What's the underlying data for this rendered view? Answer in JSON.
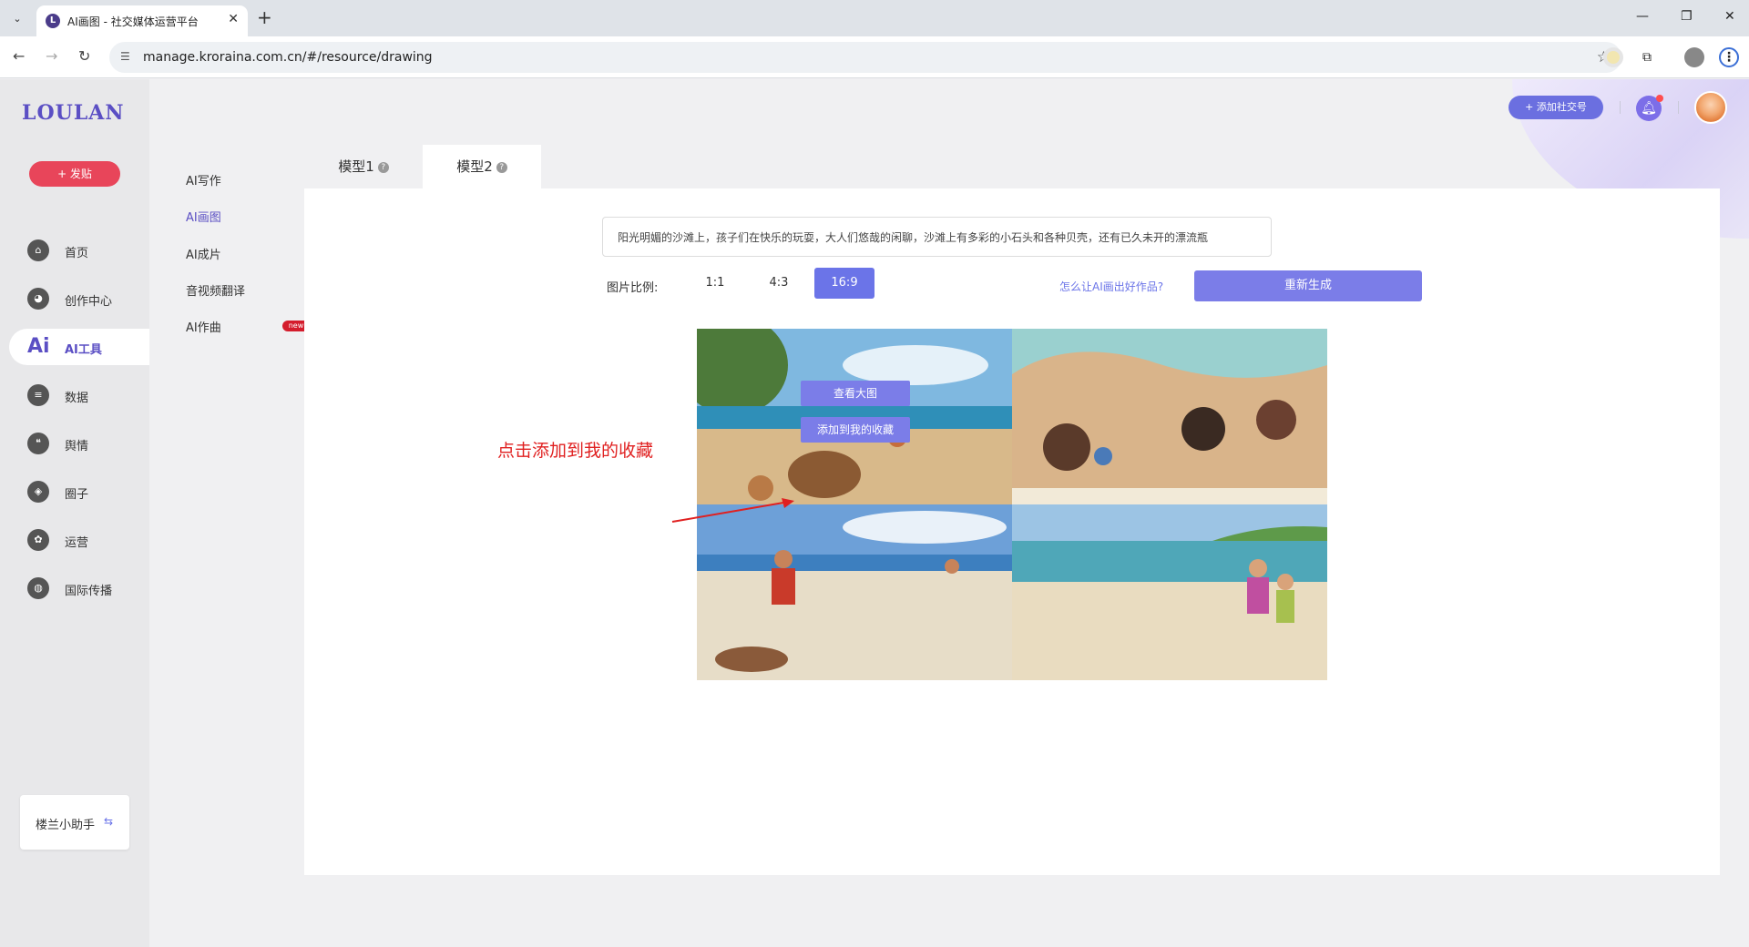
{
  "browser": {
    "tab_title": "AI画图 - 社交媒体运营平台",
    "url": "manage.kroraina.com.cn/#/resource/drawing"
  },
  "brand": {
    "logo": "LOULAN"
  },
  "sidebar": {
    "post_button": "+ 发贴",
    "items": [
      {
        "label": "首页",
        "icon": "home-icon"
      },
      {
        "label": "创作中心",
        "icon": "palette-icon"
      },
      {
        "label": "AI工具",
        "icon": "ai-icon",
        "active": true
      },
      {
        "label": "数据",
        "icon": "database-icon"
      },
      {
        "label": "舆情",
        "icon": "quote-icon"
      },
      {
        "label": "圈子",
        "icon": "compass-icon"
      },
      {
        "label": "运营",
        "icon": "operations-icon"
      },
      {
        "label": "国际传播",
        "icon": "globe-icon"
      }
    ],
    "helper": "楼兰小助手"
  },
  "subnav": {
    "items": [
      {
        "label": "AI写作"
      },
      {
        "label": "AI画图",
        "active": true
      },
      {
        "label": "AI成片"
      },
      {
        "label": "音视频翻译"
      },
      {
        "label": "AI作曲",
        "badge": "new"
      }
    ]
  },
  "header": {
    "add_social": "+ 添加社交号"
  },
  "model_tabs": [
    {
      "label": "模型1"
    },
    {
      "label": "模型2",
      "active": true
    }
  ],
  "drawing": {
    "prompt": "阳光明媚的沙滩上，孩子们在快乐的玩耍，大人们悠哉的闲聊，沙滩上有多彩的小石头和各种贝壳，还有已久未开的漂流瓶",
    "ratio_label": "图片比例:",
    "ratios": [
      "1:1",
      "4:3",
      "16:9"
    ],
    "selected_ratio": "16:9",
    "tips_link": "怎么让AI画出好作品?",
    "regenerate": "重新生成",
    "overlay": {
      "view_large": "查看大图",
      "add_favorite": "添加到我的收藏"
    }
  },
  "annotation": "点击添加到我的收藏",
  "colors": {
    "accent": "#6b74e8",
    "brand": "#5b4fc4",
    "post": "#e8455a",
    "annotation": "#e02020"
  }
}
